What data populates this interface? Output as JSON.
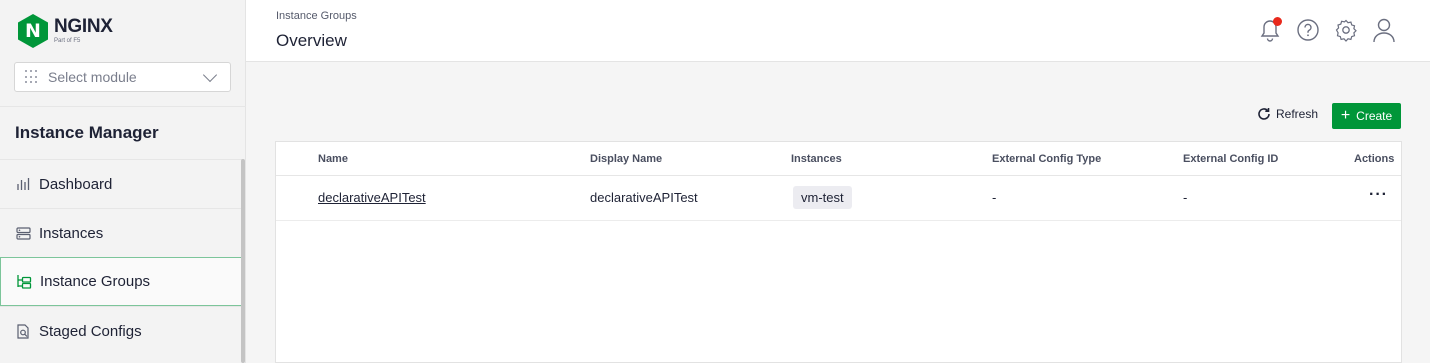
{
  "brand": {
    "logo_letter": "N",
    "name": "NGINX",
    "subtitle": "Part of F5",
    "color": "#009639"
  },
  "sidebar": {
    "module_select_placeholder": "Select module",
    "section_title": "Instance Manager",
    "items": [
      {
        "label": "Dashboard",
        "icon": "bar-chart-icon"
      },
      {
        "label": "Instances",
        "icon": "server-icon"
      },
      {
        "label": "Instance Groups",
        "icon": "instance-groups-icon",
        "active": true
      },
      {
        "label": "Staged Configs",
        "icon": "staged-configs-icon"
      }
    ]
  },
  "header": {
    "breadcrumb": "Instance Groups",
    "title": "Overview",
    "icons": [
      "bell-icon",
      "help-icon",
      "gear-icon",
      "user-icon"
    ]
  },
  "toolbar": {
    "refresh_label": "Refresh",
    "create_label": "Create"
  },
  "table": {
    "columns": [
      "Name",
      "Display Name",
      "Instances",
      "External Config Type",
      "External Config ID",
      "Actions"
    ],
    "rows": [
      {
        "name": "declarativeAPITest",
        "display_name": "declarativeAPITest",
        "instances": "vm-test",
        "ext_type": "-",
        "ext_id": "-",
        "actions": "···"
      }
    ]
  }
}
